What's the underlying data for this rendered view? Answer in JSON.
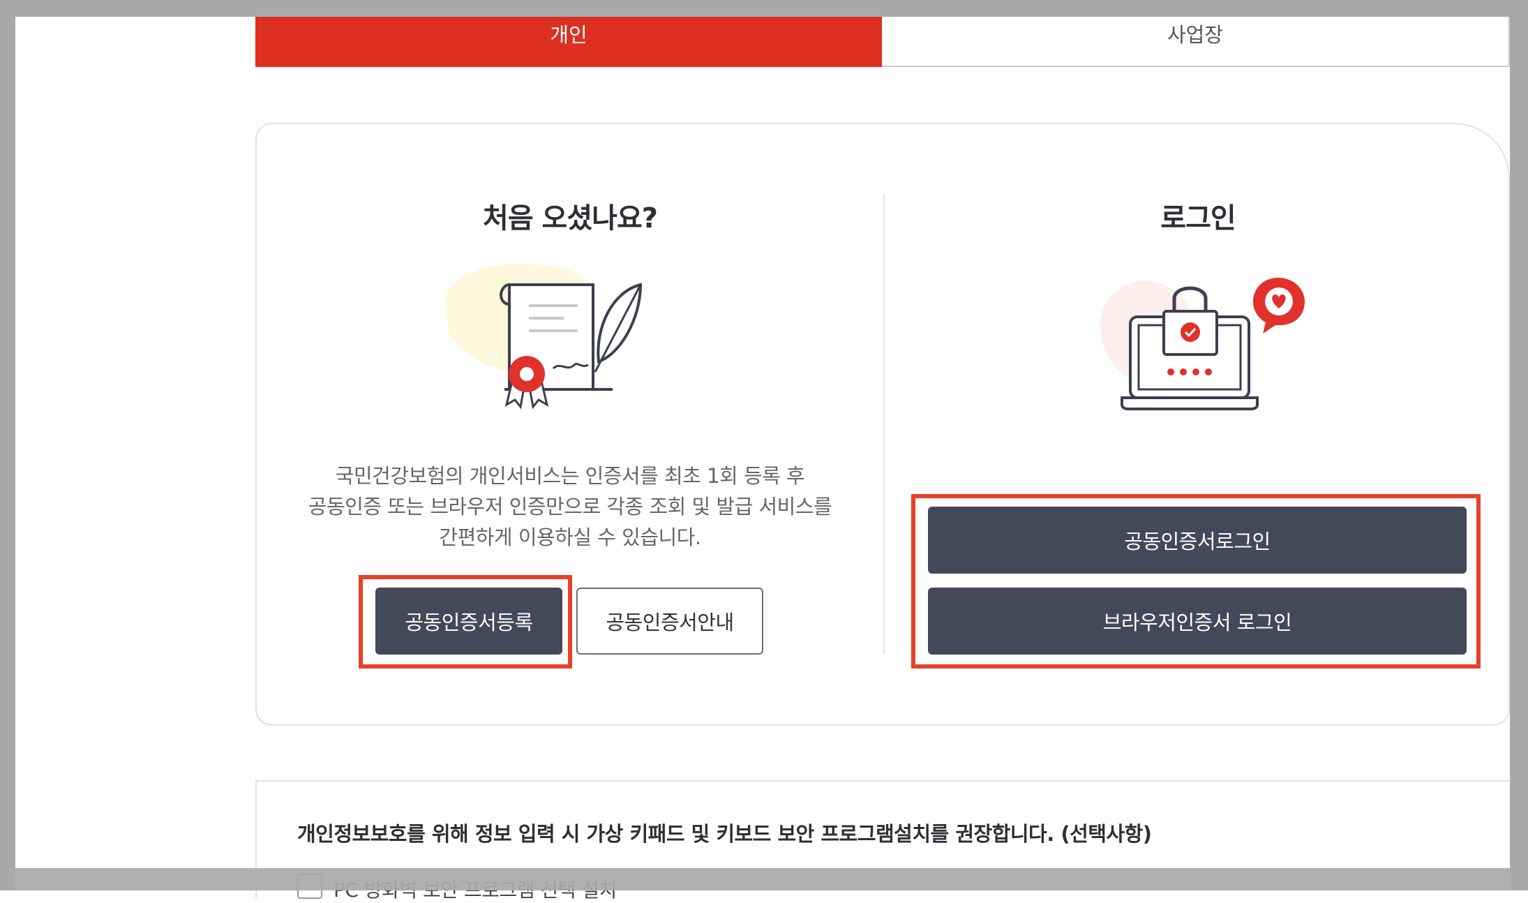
{
  "tabs": {
    "personal": "개인",
    "business": "사업장"
  },
  "first_visit": {
    "title": "처음 오셨나요?",
    "description": [
      "국민건강보험의 개인서비스는 인증서를 최초 1회 등록 후",
      "공동인증 또는 브라우저 인증만으로 각종 조회 및 발급 서비스를",
      "간편하게 이용하실 수 있습니다."
    ],
    "register_button": "공동인증서등록",
    "guide_button": "공동인증서안내"
  },
  "login": {
    "title": "로그인",
    "joint_cert_login_button": "공동인증서로그인",
    "browser_cert_login_button": "브라우저인증서 로그인"
  },
  "security": {
    "notice": "개인정보보호를 위해 정보 입력 시 가상 키패드 및 키보드 보안 프로그램설치를 권장합니다. (선택사항)",
    "checkbox_label": "PC 방화벽 보안 프로그램 선택 설치"
  },
  "colors": {
    "accent_red": "#dd3021",
    "button_dark": "#454858",
    "highlight_box": "#e8412a"
  }
}
